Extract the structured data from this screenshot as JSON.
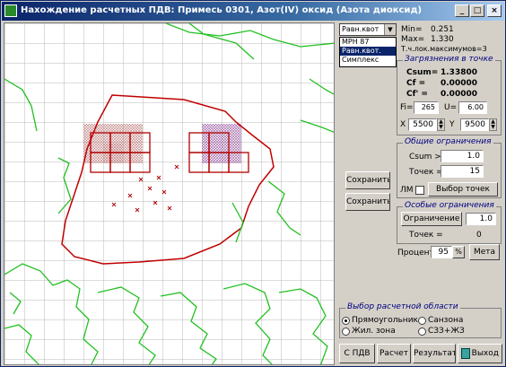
{
  "window": {
    "title": "Нахождение расчетных ПДВ: Примесь 0301, Азот(IV) оксид (Азота диоксид)",
    "btn_min": "_",
    "btn_max": "□",
    "btn_close": "×"
  },
  "mode_select": {
    "value": "Равн.квот",
    "options": [
      "МРН 87",
      "Равн.квот.",
      "Симплекс"
    ]
  },
  "stats": {
    "min_label": "Min=",
    "min_value": "0.251",
    "max_label": "Max=",
    "max_value": "1.330",
    "max_points_label": "Т.ч.лок.максимумов=3"
  },
  "point_group": {
    "title": "Загрязнения в точке",
    "csum_label": "Csum=",
    "csum_value": "1.33800",
    "cf_label": "Cf =",
    "cf_value": "0.00000",
    "cf2_label": "Cf' =",
    "cf2_value": "0.00000",
    "fi_label": "Fi=",
    "fi_value": "265",
    "u_label": "U=",
    "u_value": "6.00",
    "x_label": "X",
    "x_value": "5500",
    "y_label": "Y",
    "y_value": "9500"
  },
  "general_group": {
    "title": "Общие ограничения",
    "csum_label": "Csum >",
    "csum_value": "1.0",
    "points_label": "Точек =",
    "points_value": "15",
    "lm_label": "ЛМ",
    "select_button": "Выбор точек"
  },
  "special_group": {
    "title": "Особые ограничения",
    "limit_button": "Ограничение",
    "limit_value": "1.0",
    "points_label": "Точек =",
    "points_value": "0"
  },
  "percent": {
    "label": "Процент",
    "value": "95",
    "mark": "%",
    "button": "Мета"
  },
  "middle_buttons": {
    "b1": "Сохранить",
    "b2": "Сохранить"
  },
  "area_group": {
    "title": "Выбор расчетной области",
    "options": [
      "Прямоугольник",
      "Жил. зона",
      "Санзона",
      "СЗЗ+ЖЗ"
    ],
    "selected": 0
  },
  "bottom_buttons": {
    "b1": "С ПДВ",
    "b2": "Расчет",
    "b3": "Результат",
    "b4": "Выход"
  }
}
